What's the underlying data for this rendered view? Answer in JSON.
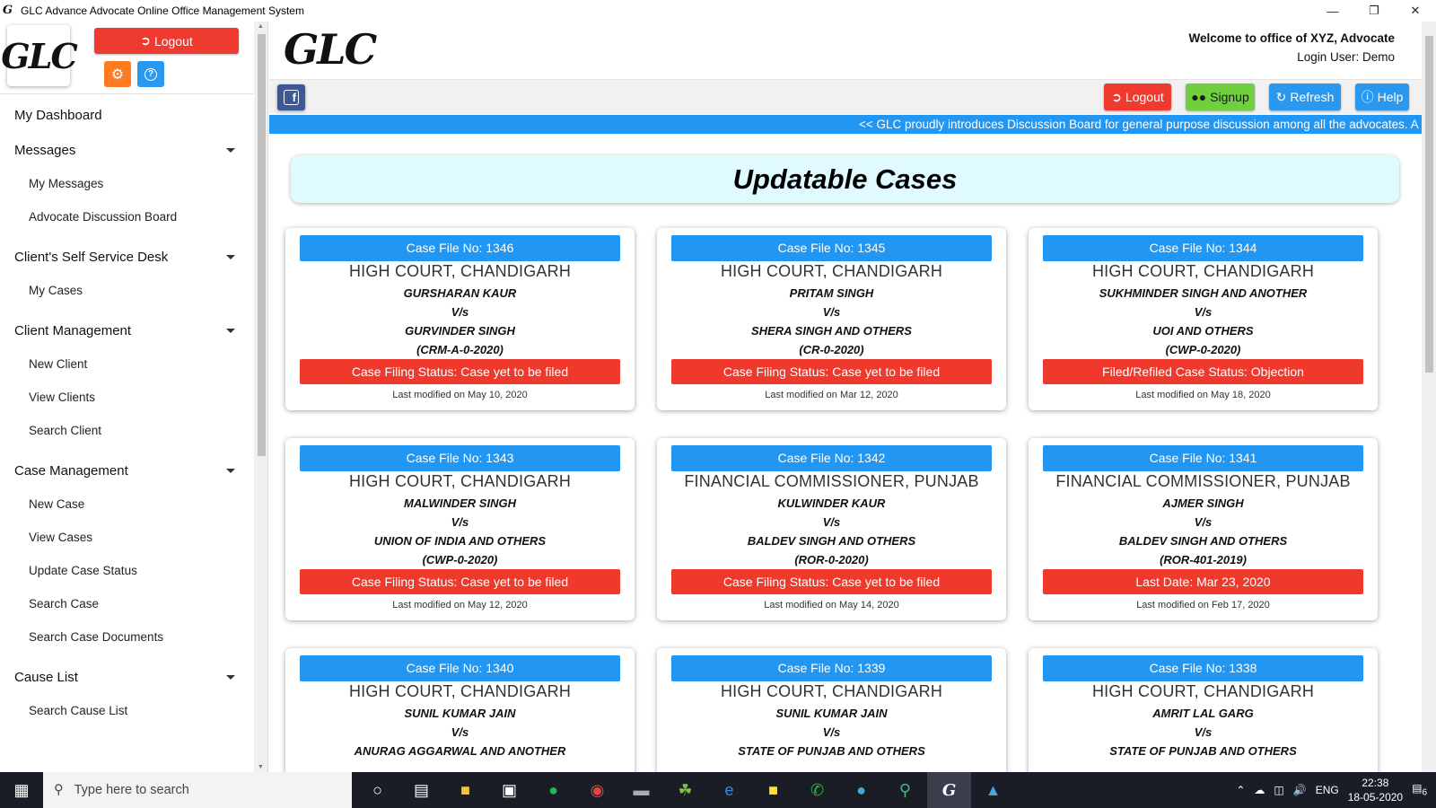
{
  "window": {
    "title": "GLC Advance Advocate Online Office Management System",
    "controls": [
      "minimize",
      "restore",
      "close"
    ]
  },
  "sidebar": {
    "logout_label": "Logout",
    "dashboard": "My Dashboard",
    "sections": [
      {
        "label": "Messages",
        "items": [
          "My Messages",
          "Advocate Discussion Board"
        ]
      },
      {
        "label": "Client's Self Service Desk",
        "items": [
          "My Cases"
        ]
      },
      {
        "label": "Client Management",
        "items": [
          "New Client",
          "View Clients",
          "Search Client"
        ]
      },
      {
        "label": "Case Management",
        "items": [
          "New Case",
          "View Cases",
          "Update Case Status",
          "Search Case",
          "Search Case Documents"
        ]
      },
      {
        "label": "Cause List",
        "items": [
          "Search Cause List"
        ]
      }
    ]
  },
  "header": {
    "welcome": "Welcome to office of XYZ, Advocate",
    "login_user": "Login User: Demo"
  },
  "toolbar": {
    "logout": "Logout",
    "signup": "Signup",
    "refresh": "Refresh",
    "help": "Help"
  },
  "ticker": "<< GLC proudly introduces Discussion Board for general purpose discussion among all the advocates. A",
  "page_title": "Updatable Cases",
  "cases": [
    {
      "file": "Case File No: 1346",
      "court": "HIGH COURT, CHANDIGARH",
      "p1": "GURSHARAN KAUR",
      "vs": "V/s",
      "p2": "GURVINDER SINGH",
      "caseno": "(CRM-A-0-2020)",
      "status": "Case Filing Status: Case yet to be filed",
      "modified": "Last modified on May 10, 2020"
    },
    {
      "file": "Case File No: 1345",
      "court": "HIGH COURT, CHANDIGARH",
      "p1": "PRITAM SINGH",
      "vs": "V/s",
      "p2": "SHERA SINGH AND OTHERS",
      "caseno": "(CR-0-2020)",
      "status": "Case Filing Status: Case yet to be filed",
      "modified": "Last modified on Mar 12, 2020"
    },
    {
      "file": "Case File No: 1344",
      "court": "HIGH COURT, CHANDIGARH",
      "p1": "SUKHMINDER SINGH AND ANOTHER",
      "vs": "V/s",
      "p2": "UOI AND OTHERS",
      "caseno": "(CWP-0-2020)",
      "status": "Filed/Refiled Case Status: Objection",
      "modified": "Last modified on May 18, 2020"
    },
    {
      "file": "Case File No: 1343",
      "court": "HIGH COURT, CHANDIGARH",
      "p1": "MALWINDER SINGH",
      "vs": "V/s",
      "p2": "UNION OF INDIA AND OTHERS",
      "caseno": "(CWP-0-2020)",
      "status": "Case Filing Status: Case yet to be filed",
      "modified": "Last modified on May 12, 2020"
    },
    {
      "file": "Case File No: 1342",
      "court": "FINANCIAL COMMISSIONER, PUNJAB",
      "p1": "KULWINDER KAUR",
      "vs": "V/s",
      "p2": "BALDEV SINGH AND OTHERS",
      "caseno": "(ROR-0-2020)",
      "status": "Case Filing Status: Case yet to be filed",
      "modified": "Last modified on May 14, 2020"
    },
    {
      "file": "Case File No: 1341",
      "court": "FINANCIAL COMMISSIONER, PUNJAB",
      "p1": "AJMER SINGH",
      "vs": "V/s",
      "p2": "BALDEV SINGH AND OTHERS",
      "caseno": "(ROR-401-2019)",
      "status": "Last Date: Mar 23, 2020",
      "modified": "Last modified on Feb 17, 2020"
    },
    {
      "file": "Case File No: 1340",
      "court": "HIGH COURT, CHANDIGARH",
      "p1": "SUNIL KUMAR JAIN",
      "vs": "V/s",
      "p2": "ANURAG AGGARWAL AND ANOTHER",
      "caseno": "",
      "status": "",
      "modified": ""
    },
    {
      "file": "Case File No: 1339",
      "court": "HIGH COURT, CHANDIGARH",
      "p1": "SUNIL KUMAR JAIN",
      "vs": "V/s",
      "p2": "STATE OF PUNJAB AND OTHERS",
      "caseno": "",
      "status": "",
      "modified": ""
    },
    {
      "file": "Case File No: 1338",
      "court": "HIGH COURT, CHANDIGARH",
      "p1": "AMRIT LAL GARG",
      "vs": "V/s",
      "p2": "STATE OF PUNJAB AND OTHERS",
      "caseno": "",
      "status": "",
      "modified": ""
    }
  ],
  "taskbar": {
    "search_placeholder": "Type here to search",
    "language": "ENG",
    "time": "22:38",
    "date": "18-05-2020",
    "notification_count": "6"
  },
  "colors": {
    "accent_blue": "#2196f3",
    "status_red": "#f0392d",
    "logout_red": "#ef3a2f",
    "signup_green": "#6fcf3e",
    "title_bg": "#e0fbff"
  }
}
